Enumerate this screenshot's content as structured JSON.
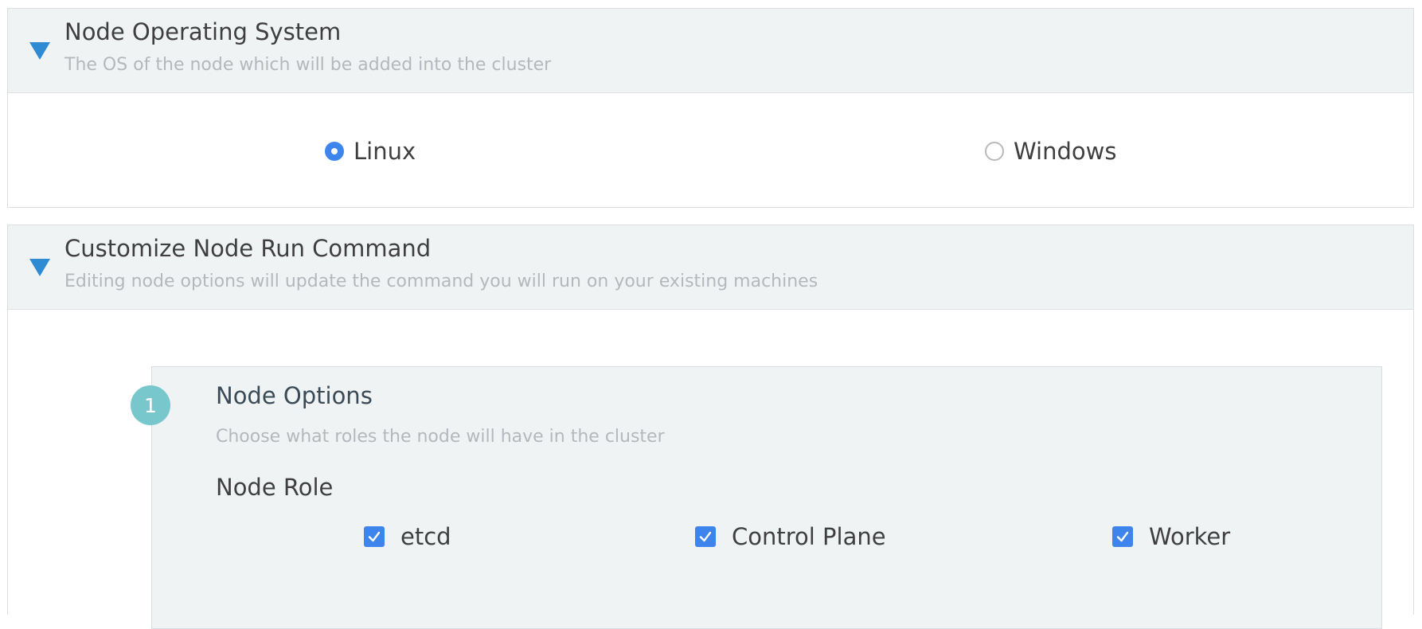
{
  "os_section": {
    "title": "Node Operating System",
    "subtitle": "The OS of the node which will be added into the cluster",
    "options": [
      {
        "label": "Linux",
        "selected": true
      },
      {
        "label": "Windows",
        "selected": false
      }
    ]
  },
  "command_section": {
    "title": "Customize Node Run Command",
    "subtitle": "Editing node options will update the command you will run on your existing machines",
    "step": {
      "number": "1",
      "title": "Node Options",
      "subtitle": "Choose what roles the node will have in the cluster",
      "role_label": "Node Role",
      "roles": [
        {
          "label": "etcd",
          "checked": true
        },
        {
          "label": "Control Plane",
          "checked": true
        },
        {
          "label": "Worker",
          "checked": true
        }
      ]
    }
  },
  "colors": {
    "accent": "#3d85ed",
    "triangle": "#2e8ad3",
    "step_badge": "#78c7cc",
    "header_bg": "#f0f3f4"
  }
}
